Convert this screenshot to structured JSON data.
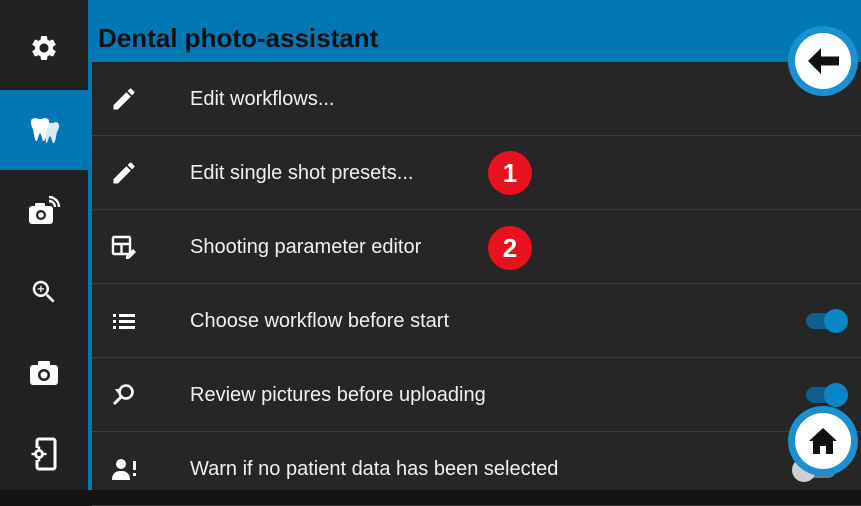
{
  "header": {
    "title": "Dental photo-assistant"
  },
  "sidebar": {
    "items": [
      {
        "icon": "gear-icon",
        "active": false
      },
      {
        "icon": "teeth-icon",
        "active": true
      },
      {
        "icon": "camera-wireless-icon",
        "active": false
      },
      {
        "icon": "zoom-in-icon",
        "active": false
      },
      {
        "icon": "camera-icon",
        "active": false
      },
      {
        "icon": "device-settings-icon",
        "active": false
      }
    ]
  },
  "settings": {
    "rows": [
      {
        "icon": "pencil-icon",
        "label": "Edit workflows..."
      },
      {
        "icon": "pencil-icon",
        "label": "Edit single shot presets...",
        "badge": "1"
      },
      {
        "icon": "table-edit-icon",
        "label": "Shooting parameter editor",
        "badge": "2"
      },
      {
        "icon": "list-icon",
        "label": "Choose workflow before start",
        "toggle": "on"
      },
      {
        "icon": "search-refresh-icon",
        "label": "Review pictures before uploading",
        "toggle": "on"
      },
      {
        "icon": "person-alert-icon",
        "label": "Warn if no patient data has been selected",
        "toggle": "off"
      }
    ]
  },
  "buttons": {
    "back": "arrow-left-icon",
    "home": "home-icon"
  },
  "colors": {
    "accent": "#0078b4",
    "badge": "#e8121c",
    "toggle_on": "#0a86c6",
    "background": "#262626"
  }
}
